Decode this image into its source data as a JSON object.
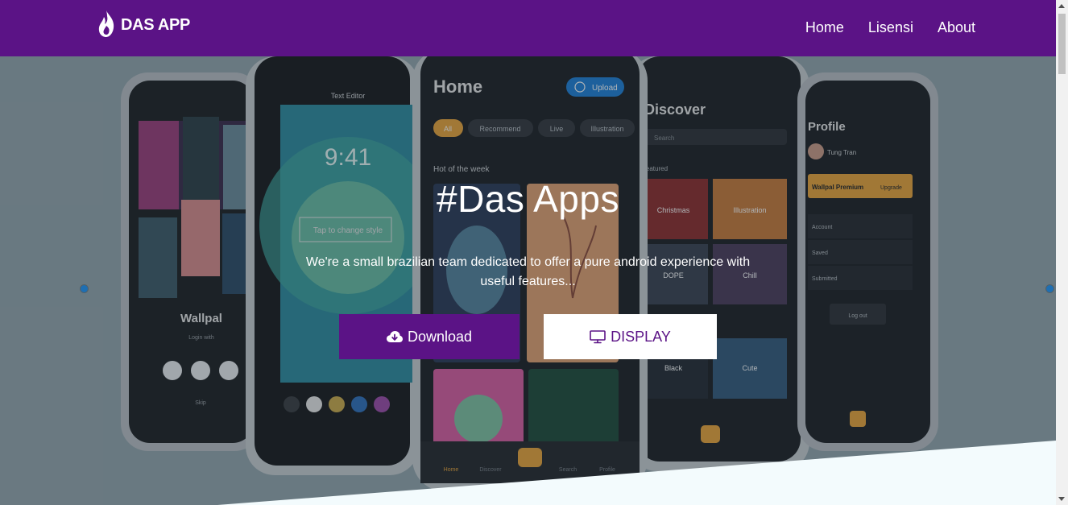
{
  "brand": {
    "name": "DAS APP",
    "icon": "flame-icon"
  },
  "nav": {
    "items": [
      "Home",
      "Lisensi",
      "About"
    ]
  },
  "hero": {
    "title": "#Das Apps",
    "subtitle": "We're a small brazilian team dedicated to offer a pure android experience with useful features...",
    "download_label": "Download",
    "download_icon": "cloud-download-icon",
    "display_label": "DISPLAY",
    "display_icon": "monitor-icon"
  },
  "mockup": {
    "editor_title": "Text Editor",
    "editor_time": "9:41",
    "editor_hint": "Tap to change style",
    "home_title": "Home",
    "upload_label": "Upload",
    "chips": [
      "All",
      "Recommend",
      "Live",
      "Illustration"
    ],
    "hot_label": "Hot of the week",
    "discover_title": "Discover",
    "search_placeholder": "Search",
    "featured_label": "Featured",
    "categories": [
      "Christmas",
      "Illustration",
      "DOPE",
      "Chill",
      "Black",
      "Cute"
    ],
    "profile_title": "Profile",
    "profile_user": "Tung Tran",
    "premium_label": "Wallpal Premium",
    "upgrade_label": "Upgrade",
    "profile_rows": [
      "Account",
      "Saved",
      "Submitted"
    ],
    "logout_label": "Log out",
    "wallpal_title": "Wallpal",
    "login_with": "Login with",
    "skip_label": "Skip",
    "status_time": "9:41",
    "tabbar": [
      "Home",
      "Discover",
      "Search",
      "Profile"
    ]
  },
  "colors": {
    "primary": "#5b1386",
    "hero_bg": "#8fa1a8",
    "white": "#ffffff",
    "wave": "#f3fbfd",
    "accent_orange": "#e8a33a",
    "upload_blue": "#1e7fd6"
  }
}
